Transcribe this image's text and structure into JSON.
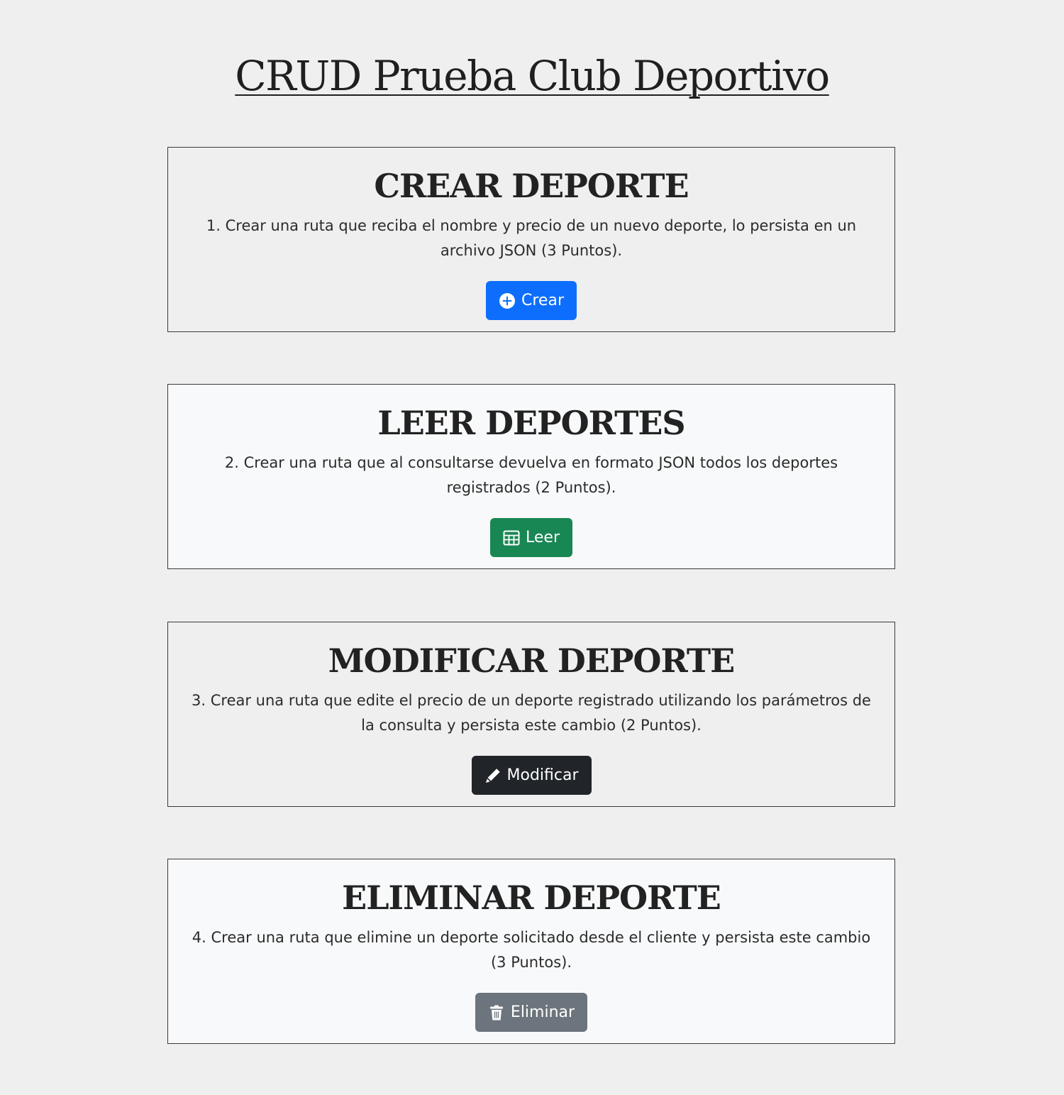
{
  "page": {
    "title": "CRUD Prueba Club Deportivo"
  },
  "cards": [
    {
      "title": "CREAR DEPORTE",
      "text": "1. Crear una ruta que reciba el nombre y precio de un nuevo deporte, lo persista en un archivo JSON (3 Puntos).",
      "button_label": "Crear",
      "button_icon": "plus-circle-icon",
      "button_color": "#0d6efd"
    },
    {
      "title": "LEER DEPORTES",
      "text": "2. Crear una ruta que al consultarse devuelva en formato JSON todos los deportes registrados (2 Puntos).",
      "button_label": "Leer",
      "button_icon": "table-icon",
      "button_color": "#198754"
    },
    {
      "title": "MODIFICAR DEPORTE",
      "text": "3. Crear una ruta que edite el precio de un deporte registrado utilizando los parámetros de la consulta y persista este cambio (2 Puntos).",
      "button_label": "Modificar",
      "button_icon": "pencil-icon",
      "button_color": "#212529"
    },
    {
      "title": "ELIMINAR DEPORTE",
      "text": "4. Crear una ruta que elimine un deporte solicitado desde el cliente y persista este cambio (3 Puntos).",
      "button_label": "Eliminar",
      "button_icon": "trash-icon",
      "button_color": "#6c757d"
    }
  ]
}
